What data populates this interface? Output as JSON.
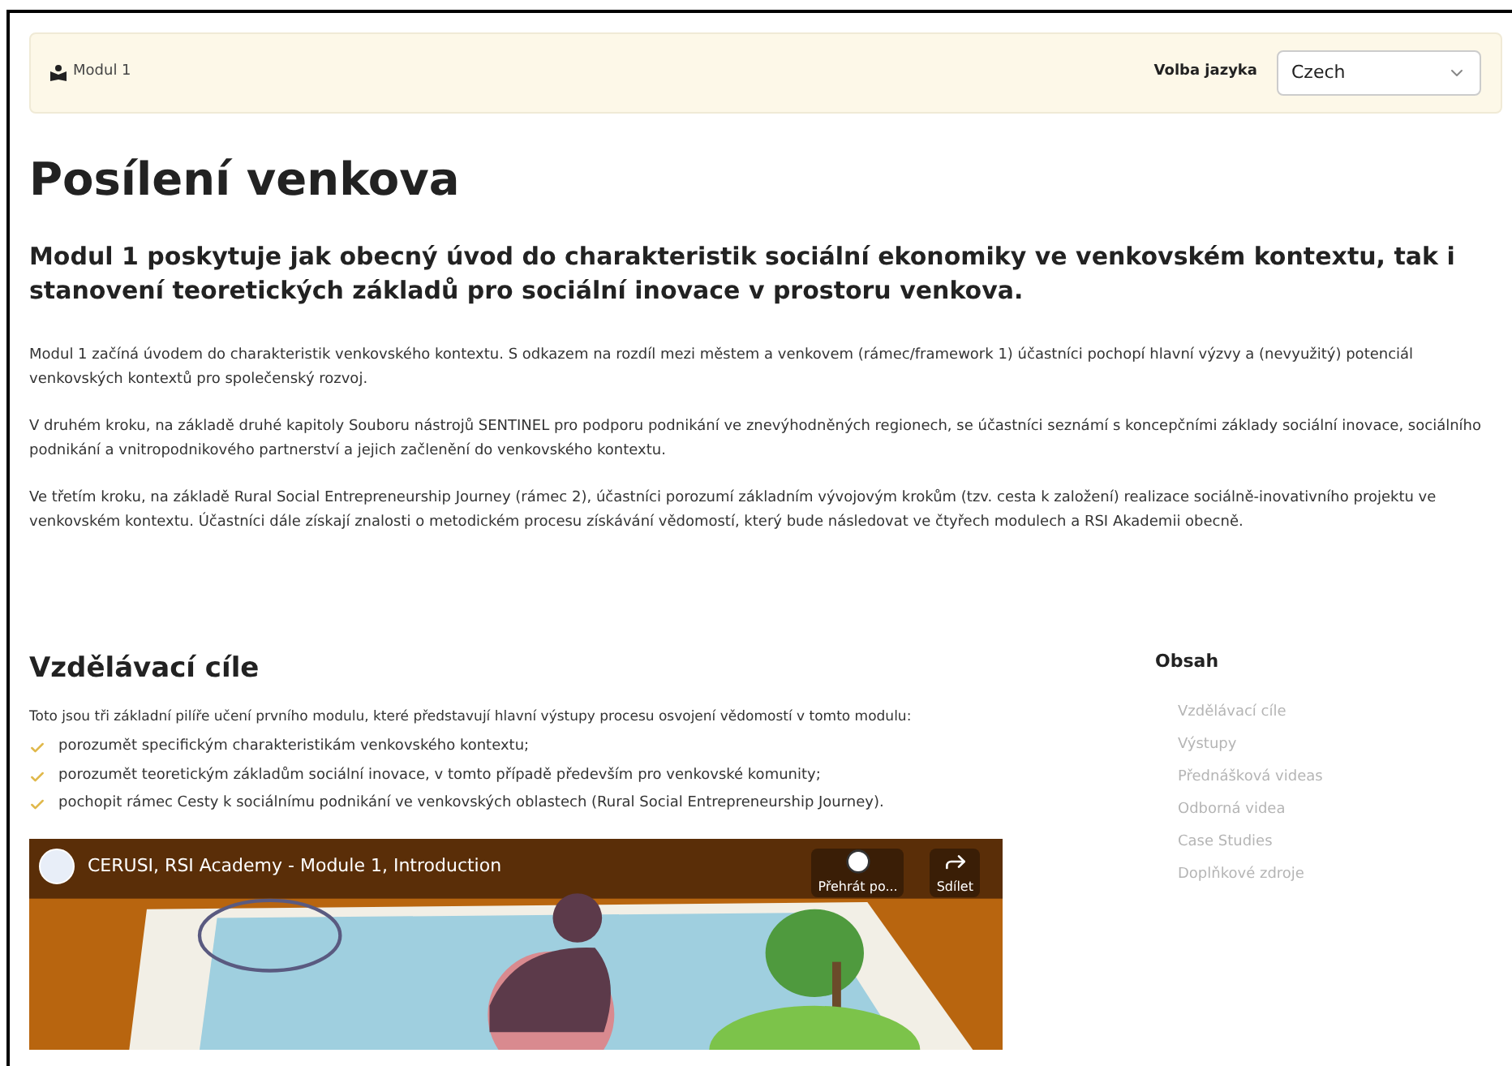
{
  "header": {
    "module_label": "Modul 1",
    "language_label": "Volba jazyka",
    "language_value": "Czech"
  },
  "title": "Posílení venkova",
  "lead": "Modul 1 poskytuje jak obecný úvod do charakteristik sociální ekonomiky ve venkovském kontextu, tak i stanovení teoretických základů pro sociální inovace v prostoru venkova.",
  "paragraphs": [
    "Modul 1 začíná úvodem do charakteristik venkovského kontextu. S odkazem na rozdíl mezi městem a venkovem (rámec/framework 1) účastníci pochopí hlavní výzvy a (nevyužitý) potenciál venkovských kontextů pro společenský rozvoj.",
    "V druhém kroku, na základě druhé kapitoly Souboru nástrojů SENTINEL pro podporu podnikání ve znevýhodněných regionech, se účastníci seznámí s koncepčními základy sociální inovace, sociálního podnikání a vnitropodnikového partnerství a jejich začlenění do venkovského kontextu.",
    "Ve třetím kroku, na základě Rural Social Entrepreneurship Journey (rámec 2), účastníci porozumí základním vývojovým krokům (tzv. cesta k založení) realizace sociálně-inovativního projektu ve venkovském kontextu. Účastníci dále získají znalosti o metodickém procesu získávání vědomostí, který bude následovat ve čtyřech modulech a RSI Akademii obecně."
  ],
  "section": {
    "heading": "Vzdělávací cíle",
    "intro": "Toto jsou tři základní pilíře učení prvního modulu, které představují hlavní výstupy procesu osvojení vědomostí v tomto modulu:",
    "goals": [
      "porozumět specifickým charakteristikám venkovského kontextu;",
      "porozumět teoretickým základům sociální inovace, v tomto případě především pro venkovské komunity;",
      "pochopit rámec Cesty k sociálnímu podnikání ve venkovských oblastech (Rural Social Entrepreneurship Journey)."
    ]
  },
  "video": {
    "title": "CERUSI, RSI Academy - Module 1, Introduction",
    "actions": [
      {
        "kind": "watch_later",
        "label": "Přehrát po..."
      },
      {
        "kind": "share",
        "label": "Sdílet"
      }
    ]
  },
  "toc": {
    "heading": "Obsah",
    "items": [
      "Vzdělávací cíle",
      "Výstupy",
      "Přednášková videas",
      "Odborná videa",
      "Case Studies",
      "Doplňkové zdroje"
    ]
  }
}
